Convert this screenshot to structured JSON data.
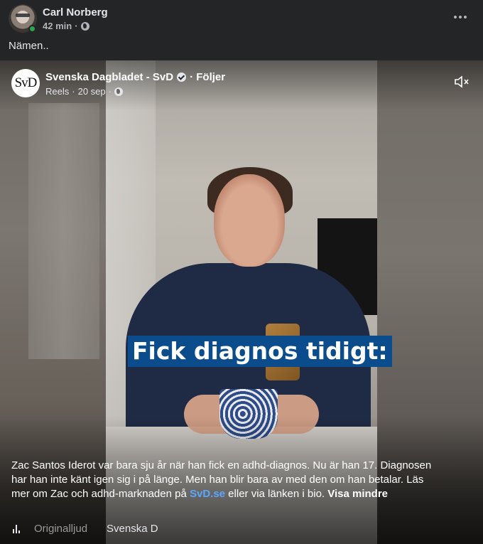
{
  "post": {
    "author": "Carl Norberg",
    "time": "42 min",
    "separator": "·",
    "text": "Nämen.."
  },
  "reel": {
    "page_name": "Svenska Dagbladet - SvD",
    "page_avatar_text": "SvD",
    "follow_label": "· Följer",
    "source": "Reels",
    "date": "20 sep",
    "overlay_caption": "Fick diagnos tidigt:",
    "description_part1": "Zac Santos Iderot var bara sju år när han fick en adhd-diagnos. Nu är han 17. Diagnosen har han inte känt igen sig i på länge. Men han blir bara av med den om han betalar. Läs mer om Zac och adhd-marknaden på ",
    "description_link": "SvD.se",
    "description_part2": " eller via länken i bio. ",
    "see_less": "Visa mindre",
    "audio_track": "Originalljud",
    "audio_artist": "Svenska D"
  },
  "icons": {
    "more": "more-horizontal-icon",
    "privacy": "globe-icon",
    "verified": "verified-badge-icon",
    "mute": "speaker-muted-icon",
    "audio": "audio-bars-icon"
  },
  "colors": {
    "background": "#242526",
    "caption_bg": "#0b4c8c",
    "link": "#5aa7ff",
    "online": "#31a24c"
  }
}
